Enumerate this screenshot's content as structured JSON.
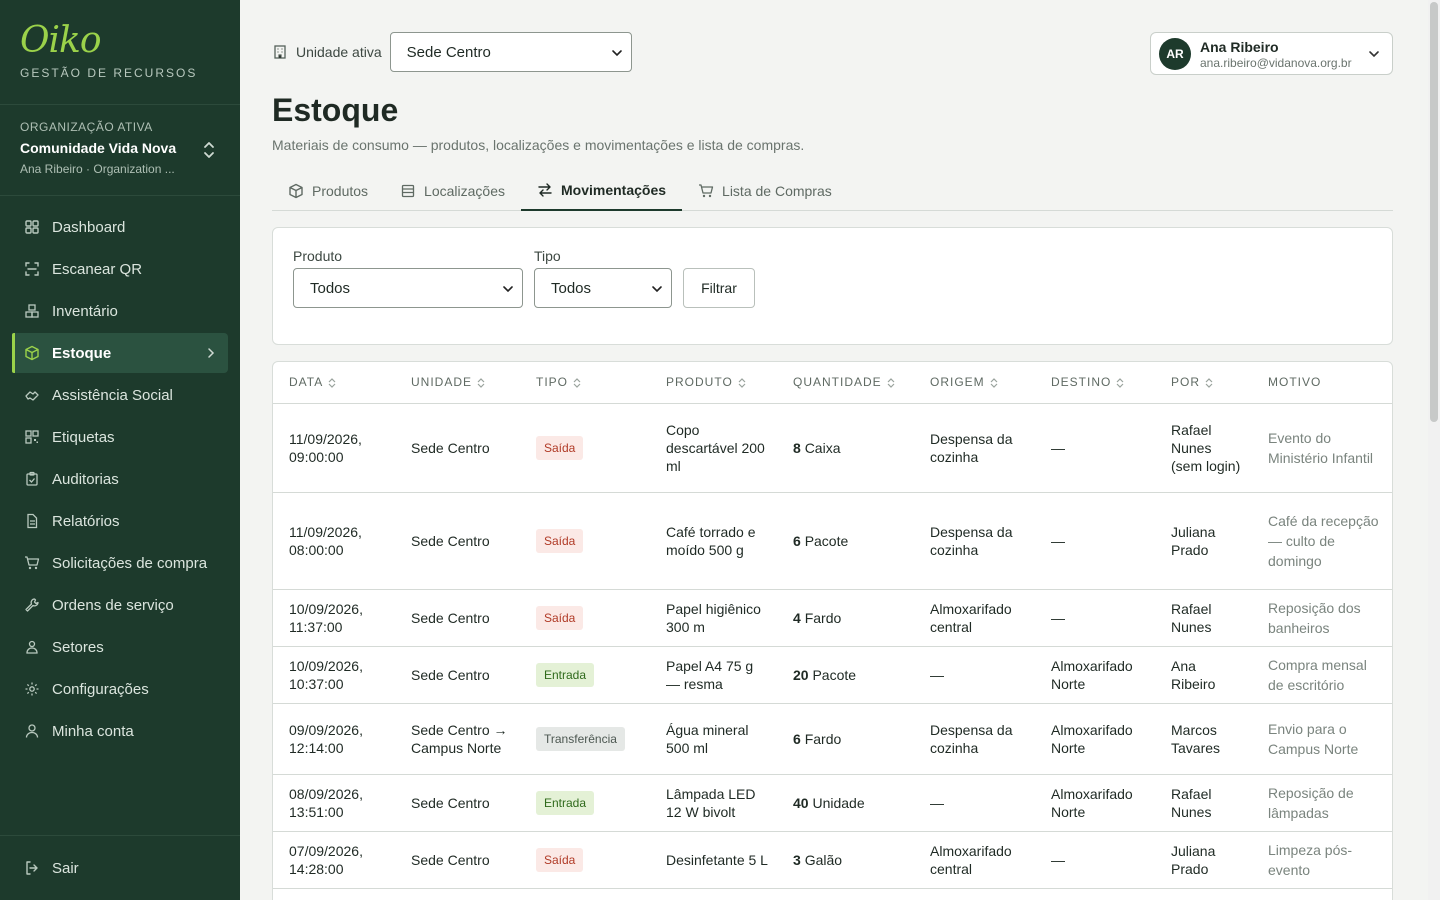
{
  "sidebar": {
    "logo": "Oiko",
    "brand_sub": "GESTÃO DE RECURSOS",
    "org_label": "ORGANIZAÇÃO ATIVA",
    "org_name": "Comunidade Vida Nova",
    "org_user": "Ana Ribeiro · Organization ...",
    "items": [
      {
        "label": "Dashboard",
        "icon": "dashboard-icon"
      },
      {
        "label": "Escanear QR",
        "icon": "scan-qr-icon"
      },
      {
        "label": "Inventário",
        "icon": "boxes-icon"
      },
      {
        "label": "Estoque",
        "icon": "package-icon"
      },
      {
        "label": "Assistência Social",
        "icon": "handshake-icon"
      },
      {
        "label": "Etiquetas",
        "icon": "qr-code-icon"
      },
      {
        "label": "Auditorias",
        "icon": "clipboard-check-icon"
      },
      {
        "label": "Relatórios",
        "icon": "file-text-icon"
      },
      {
        "label": "Solicitações de compra",
        "icon": "cart-icon"
      },
      {
        "label": "Ordens de serviço",
        "icon": "wrench-icon"
      },
      {
        "label": "Setores",
        "icon": "sectors-icon"
      },
      {
        "label": "Configurações",
        "icon": "gear-icon"
      },
      {
        "label": "Minha conta",
        "icon": "user-icon"
      }
    ],
    "logout": "Sair"
  },
  "header": {
    "unit_label": "Unidade ativa",
    "unit_value": "Sede Centro",
    "user_initials": "AR",
    "user_name": "Ana Ribeiro",
    "user_email": "ana.ribeiro@vidanova.org.br"
  },
  "page": {
    "title": "Estoque",
    "subtitle": "Materiais de consumo — produtos, localizações e movimentações e lista de compras."
  },
  "tabs": [
    {
      "label": "Produtos",
      "icon": "package-icon"
    },
    {
      "label": "Localizações",
      "icon": "building-icon"
    },
    {
      "label": "Movimentações",
      "icon": "arrows-icon"
    },
    {
      "label": "Lista de Compras",
      "icon": "cart-icon"
    }
  ],
  "filters": {
    "produto_label": "Produto",
    "produto_value": "Todos",
    "tipo_label": "Tipo",
    "tipo_value": "Todos",
    "button": "Filtrar"
  },
  "table": {
    "columns": [
      "DATA",
      "UNIDADE",
      "TIPO",
      "PRODUTO",
      "QUANTIDADE",
      "ORIGEM",
      "DESTINO",
      "POR",
      "MOTIVO"
    ],
    "rows": [
      {
        "data": "11/09/2026, 09:00:00",
        "unidade": "Sede Centro",
        "tipo": "Saída",
        "tipo_kind": "saida",
        "produto": "Copo descartável 200 ml",
        "qtd": "8",
        "unid": "Caixa",
        "origem": "Despensa da cozinha",
        "destino": "—",
        "por": "Rafael Nunes (sem login)",
        "motivo": "Evento do Ministério Infantil"
      },
      {
        "data": "11/09/2026, 08:00:00",
        "unidade": "Sede Centro",
        "tipo": "Saída",
        "tipo_kind": "saida",
        "produto": "Café torrado e moído 500 g",
        "qtd": "6",
        "unid": "Pacote",
        "origem": "Despensa da cozinha",
        "destino": "—",
        "por": "Juliana Prado",
        "motivo": "Café da recepção — culto de domingo"
      },
      {
        "data": "10/09/2026, 11:37:00",
        "unidade": "Sede Centro",
        "tipo": "Saída",
        "tipo_kind": "saida",
        "produto": "Papel higiênico 300 m",
        "qtd": "4",
        "unid": "Fardo",
        "origem": "Almoxarifado central",
        "destino": "—",
        "por": "Rafael Nunes",
        "motivo": "Reposição dos banheiros"
      },
      {
        "data": "10/09/2026, 10:37:00",
        "unidade": "Sede Centro",
        "tipo": "Entrada",
        "tipo_kind": "entrada",
        "produto": "Papel A4 75 g — resma",
        "qtd": "20",
        "unid": "Pacote",
        "origem": "—",
        "destino": "Almoxarifado Norte",
        "por": "Ana Ribeiro",
        "motivo": "Compra mensal de escritório"
      },
      {
        "data": "09/09/2026, 12:14:00",
        "unidade": "Sede Centro → Campus Norte",
        "tipo": "Transferência",
        "tipo_kind": "transferencia",
        "produto": "Água mineral 500 ml",
        "qtd": "6",
        "unid": "Fardo",
        "origem": "Despensa da cozinha",
        "destino": "Almoxarifado Norte",
        "por": "Marcos Tavares",
        "motivo": "Envio para o Campus Norte"
      },
      {
        "data": "08/09/2026, 13:51:00",
        "unidade": "Sede Centro",
        "tipo": "Entrada",
        "tipo_kind": "entrada",
        "produto": "Lâmpada LED 12 W bivolt",
        "qtd": "40",
        "unid": "Unidade",
        "origem": "—",
        "destino": "Almoxarifado Norte",
        "por": "Rafael Nunes",
        "motivo": "Reposição de lâmpadas"
      },
      {
        "data": "07/09/2026, 14:28:00",
        "unidade": "Sede Centro",
        "tipo": "Saída",
        "tipo_kind": "saida",
        "produto": "Desinfetante 5 L",
        "qtd": "3",
        "unid": "Galão",
        "origem": "Almoxarifado central",
        "destino": "—",
        "por": "Juliana Prado",
        "motivo": "Limpeza pós-evento"
      }
    ]
  }
}
